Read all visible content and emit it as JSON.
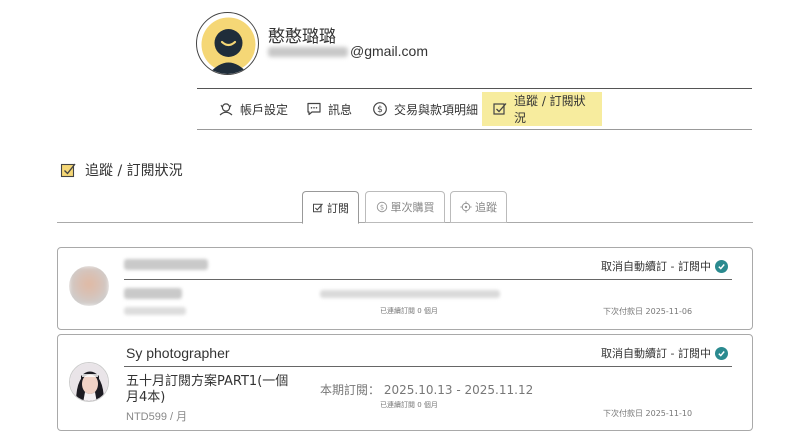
{
  "profile": {
    "name": "憨憨璐璐",
    "email_suffix": "@gmail.com"
  },
  "nav": {
    "items": [
      {
        "label": "帳戶設定",
        "icon": "account-settings-icon"
      },
      {
        "label": "訊息",
        "icon": "message-icon"
      },
      {
        "label": "交易與款項明細",
        "icon": "dollar-coin-icon"
      },
      {
        "label": "追蹤 / 訂閱狀況",
        "icon": "checkbox-edit-icon",
        "active": true
      }
    ]
  },
  "section": {
    "title": "追蹤 / 訂閱狀況"
  },
  "tabs": [
    {
      "label": "訂閱",
      "icon": "checkbox-edit-icon",
      "active": true
    },
    {
      "label": "單次購買",
      "icon": "dollar-coin-icon"
    },
    {
      "label": "追蹤",
      "icon": "crosshair-icon"
    }
  ],
  "subscriptions": [
    {
      "status": "取消自動續訂 - 訂閱中",
      "continuous_note": "已連續訂閱 0 個月",
      "next_payment": "下次付款日 2025-11-06"
    },
    {
      "creator": "Sy photographer",
      "status": "取消自動續訂 - 訂閱中",
      "plan": "五十月訂閱方案PART1(一個月4本)",
      "price": "NTD599 / 月",
      "period_label": "本期訂閱：",
      "period_value": "2025.10.13 - 2025.11.12",
      "continuous_note": "已連續訂閱 0 個月",
      "next_payment": "下次付款日 2025-11-10"
    }
  ],
  "colors": {
    "accent_yellow": "#f7ec9e",
    "check_teal": "#2a8a8f"
  }
}
